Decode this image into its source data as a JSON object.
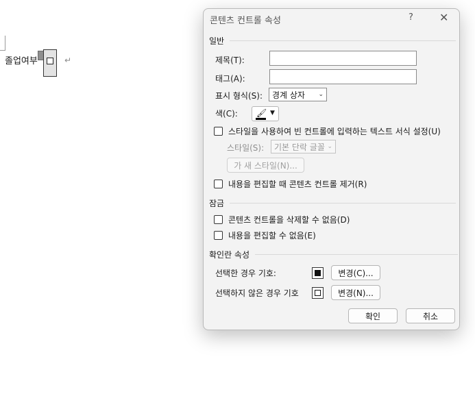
{
  "document": {
    "line_text": "졸업여부",
    "paragraph_mark": "↵"
  },
  "dialog": {
    "title": "콘텐츠 컨트롤 속성",
    "help": "?",
    "close": "✕",
    "general": {
      "header": "일반",
      "title_label": "제목(T):",
      "title_value": "",
      "tag_label": "태그(A):",
      "tag_value": "",
      "display_label": "표시 형식(S):",
      "display_value": "경계 상자",
      "color_label": "색(C):",
      "use_style_label": "스타일을 사용하여 빈 컨트롤에 입력하는 텍스트 서식 설정(U)",
      "style_label": "스타일(S):",
      "style_value": "기본 단락 글꼴",
      "new_style_label": "가 새 스타일(N)...",
      "remove_label": "내용을 편집할 때 콘텐츠 컨트롤 제거(R)"
    },
    "locking": {
      "header": "잠금",
      "cannot_delete_label": "콘텐츠 컨트롤을 삭제할 수 없음(D)",
      "cannot_edit_label": "내용을 편집할 수 없음(E)"
    },
    "checkbox_props": {
      "header": "확인란 속성",
      "checked_label": "선택한 경우 기호:",
      "unchecked_label": "선택하지 않은 경우 기호",
      "change_checked": "변경(C)...",
      "change_unchecked": "변경(N)..."
    },
    "ok": "확인",
    "cancel": "취소"
  }
}
